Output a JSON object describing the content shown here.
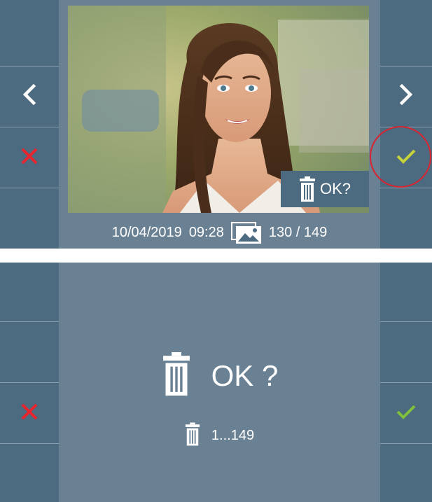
{
  "top_screen": {
    "left_panel": {
      "prev_icon": "chevron-left-icon",
      "delete_icon": "x-icon"
    },
    "right_panel": {
      "next_icon": "chevron-right-icon",
      "confirm_icon": "check-icon"
    },
    "delete_badge": {
      "icon": "trash-icon",
      "label": "OK?"
    },
    "status_bar": {
      "date": "10/04/2019",
      "time": "09:28",
      "gallery_icon": "gallery-icon",
      "counter": "130 / 149"
    }
  },
  "bottom_screen": {
    "confirm_text": "OK ?",
    "range_text": "1...149",
    "left_panel": {
      "cancel_icon": "x-icon"
    },
    "right_panel": {
      "confirm_icon": "check-icon"
    }
  },
  "colors": {
    "screen_bg": "#6a8194",
    "panel_bg": "#4d6b80",
    "cancel_red": "#e8242c",
    "confirm_green_top": "#c6d33a",
    "confirm_green_bottom": "#7fbf3a",
    "highlight_ring": "#d9242e"
  }
}
